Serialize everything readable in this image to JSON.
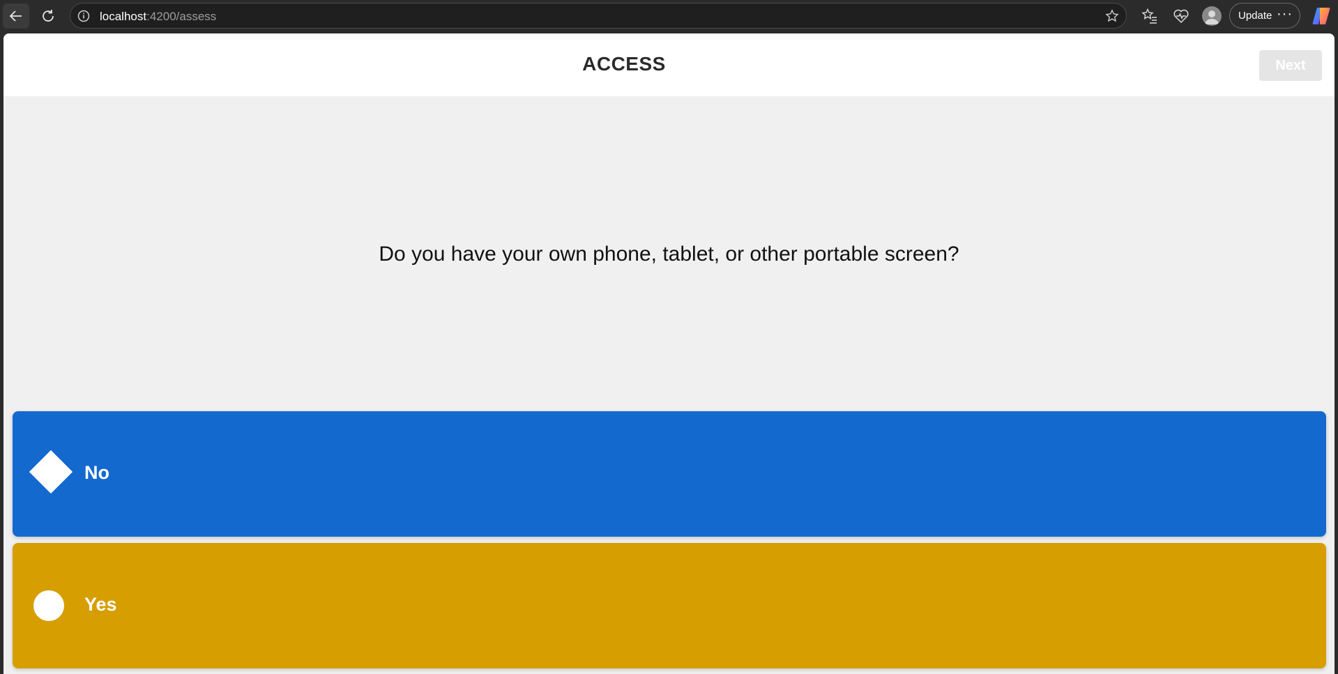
{
  "browser": {
    "url_host": "localhost",
    "url_path": ":4200/assess",
    "update_label": "Update",
    "more_label": "···"
  },
  "header": {
    "title": "ACCESS",
    "next_label": "Next"
  },
  "question": {
    "text": "Do you have your own phone, tablet, or other portable screen?"
  },
  "options": [
    {
      "label": "No",
      "shape": "diamond",
      "color": "#1469cf"
    },
    {
      "label": "Yes",
      "shape": "circle",
      "color": "#d69e00"
    }
  ]
}
